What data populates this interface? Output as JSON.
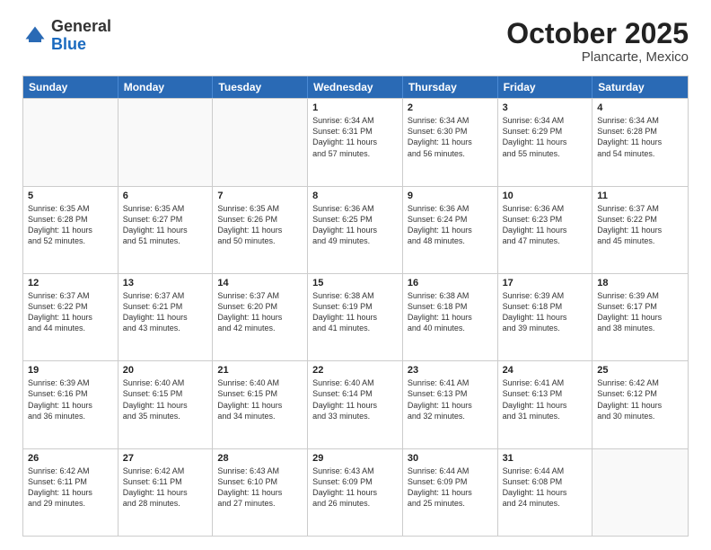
{
  "header": {
    "logo_general": "General",
    "logo_blue": "Blue",
    "month": "October 2025",
    "location": "Plancarte, Mexico"
  },
  "days_of_week": [
    "Sunday",
    "Monday",
    "Tuesday",
    "Wednesday",
    "Thursday",
    "Friday",
    "Saturday"
  ],
  "weeks": [
    [
      {
        "day": "",
        "empty": true
      },
      {
        "day": "",
        "empty": true
      },
      {
        "day": "",
        "empty": true
      },
      {
        "day": "1",
        "lines": [
          "Sunrise: 6:34 AM",
          "Sunset: 6:31 PM",
          "Daylight: 11 hours",
          "and 57 minutes."
        ]
      },
      {
        "day": "2",
        "lines": [
          "Sunrise: 6:34 AM",
          "Sunset: 6:30 PM",
          "Daylight: 11 hours",
          "and 56 minutes."
        ]
      },
      {
        "day": "3",
        "lines": [
          "Sunrise: 6:34 AM",
          "Sunset: 6:29 PM",
          "Daylight: 11 hours",
          "and 55 minutes."
        ]
      },
      {
        "day": "4",
        "lines": [
          "Sunrise: 6:34 AM",
          "Sunset: 6:28 PM",
          "Daylight: 11 hours",
          "and 54 minutes."
        ]
      }
    ],
    [
      {
        "day": "5",
        "lines": [
          "Sunrise: 6:35 AM",
          "Sunset: 6:28 PM",
          "Daylight: 11 hours",
          "and 52 minutes."
        ]
      },
      {
        "day": "6",
        "lines": [
          "Sunrise: 6:35 AM",
          "Sunset: 6:27 PM",
          "Daylight: 11 hours",
          "and 51 minutes."
        ]
      },
      {
        "day": "7",
        "lines": [
          "Sunrise: 6:35 AM",
          "Sunset: 6:26 PM",
          "Daylight: 11 hours",
          "and 50 minutes."
        ]
      },
      {
        "day": "8",
        "lines": [
          "Sunrise: 6:36 AM",
          "Sunset: 6:25 PM",
          "Daylight: 11 hours",
          "and 49 minutes."
        ]
      },
      {
        "day": "9",
        "lines": [
          "Sunrise: 6:36 AM",
          "Sunset: 6:24 PM",
          "Daylight: 11 hours",
          "and 48 minutes."
        ]
      },
      {
        "day": "10",
        "lines": [
          "Sunrise: 6:36 AM",
          "Sunset: 6:23 PM",
          "Daylight: 11 hours",
          "and 47 minutes."
        ]
      },
      {
        "day": "11",
        "lines": [
          "Sunrise: 6:37 AM",
          "Sunset: 6:22 PM",
          "Daylight: 11 hours",
          "and 45 minutes."
        ]
      }
    ],
    [
      {
        "day": "12",
        "lines": [
          "Sunrise: 6:37 AM",
          "Sunset: 6:22 PM",
          "Daylight: 11 hours",
          "and 44 minutes."
        ]
      },
      {
        "day": "13",
        "lines": [
          "Sunrise: 6:37 AM",
          "Sunset: 6:21 PM",
          "Daylight: 11 hours",
          "and 43 minutes."
        ]
      },
      {
        "day": "14",
        "lines": [
          "Sunrise: 6:37 AM",
          "Sunset: 6:20 PM",
          "Daylight: 11 hours",
          "and 42 minutes."
        ]
      },
      {
        "day": "15",
        "lines": [
          "Sunrise: 6:38 AM",
          "Sunset: 6:19 PM",
          "Daylight: 11 hours",
          "and 41 minutes."
        ]
      },
      {
        "day": "16",
        "lines": [
          "Sunrise: 6:38 AM",
          "Sunset: 6:18 PM",
          "Daylight: 11 hours",
          "and 40 minutes."
        ]
      },
      {
        "day": "17",
        "lines": [
          "Sunrise: 6:39 AM",
          "Sunset: 6:18 PM",
          "Daylight: 11 hours",
          "and 39 minutes."
        ]
      },
      {
        "day": "18",
        "lines": [
          "Sunrise: 6:39 AM",
          "Sunset: 6:17 PM",
          "Daylight: 11 hours",
          "and 38 minutes."
        ]
      }
    ],
    [
      {
        "day": "19",
        "lines": [
          "Sunrise: 6:39 AM",
          "Sunset: 6:16 PM",
          "Daylight: 11 hours",
          "and 36 minutes."
        ]
      },
      {
        "day": "20",
        "lines": [
          "Sunrise: 6:40 AM",
          "Sunset: 6:15 PM",
          "Daylight: 11 hours",
          "and 35 minutes."
        ]
      },
      {
        "day": "21",
        "lines": [
          "Sunrise: 6:40 AM",
          "Sunset: 6:15 PM",
          "Daylight: 11 hours",
          "and 34 minutes."
        ]
      },
      {
        "day": "22",
        "lines": [
          "Sunrise: 6:40 AM",
          "Sunset: 6:14 PM",
          "Daylight: 11 hours",
          "and 33 minutes."
        ]
      },
      {
        "day": "23",
        "lines": [
          "Sunrise: 6:41 AM",
          "Sunset: 6:13 PM",
          "Daylight: 11 hours",
          "and 32 minutes."
        ]
      },
      {
        "day": "24",
        "lines": [
          "Sunrise: 6:41 AM",
          "Sunset: 6:13 PM",
          "Daylight: 11 hours",
          "and 31 minutes."
        ]
      },
      {
        "day": "25",
        "lines": [
          "Sunrise: 6:42 AM",
          "Sunset: 6:12 PM",
          "Daylight: 11 hours",
          "and 30 minutes."
        ]
      }
    ],
    [
      {
        "day": "26",
        "lines": [
          "Sunrise: 6:42 AM",
          "Sunset: 6:11 PM",
          "Daylight: 11 hours",
          "and 29 minutes."
        ]
      },
      {
        "day": "27",
        "lines": [
          "Sunrise: 6:42 AM",
          "Sunset: 6:11 PM",
          "Daylight: 11 hours",
          "and 28 minutes."
        ]
      },
      {
        "day": "28",
        "lines": [
          "Sunrise: 6:43 AM",
          "Sunset: 6:10 PM",
          "Daylight: 11 hours",
          "and 27 minutes."
        ]
      },
      {
        "day": "29",
        "lines": [
          "Sunrise: 6:43 AM",
          "Sunset: 6:09 PM",
          "Daylight: 11 hours",
          "and 26 minutes."
        ]
      },
      {
        "day": "30",
        "lines": [
          "Sunrise: 6:44 AM",
          "Sunset: 6:09 PM",
          "Daylight: 11 hours",
          "and 25 minutes."
        ]
      },
      {
        "day": "31",
        "lines": [
          "Sunrise: 6:44 AM",
          "Sunset: 6:08 PM",
          "Daylight: 11 hours",
          "and 24 minutes."
        ]
      },
      {
        "day": "",
        "empty": true
      }
    ]
  ]
}
